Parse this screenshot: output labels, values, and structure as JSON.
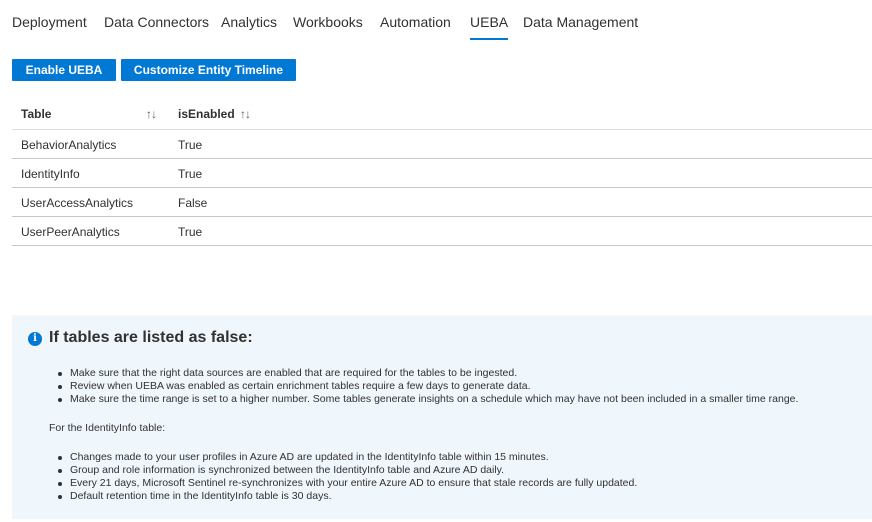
{
  "tabs": [
    {
      "label": "Deployment",
      "active": false
    },
    {
      "label": "Data Connectors",
      "active": false
    },
    {
      "label": "Analytics",
      "active": false
    },
    {
      "label": "Workbooks",
      "active": false
    },
    {
      "label": "Automation",
      "active": false
    },
    {
      "label": "UEBA",
      "active": true
    },
    {
      "label": "Data Management",
      "active": false
    }
  ],
  "toolbar": {
    "enable_ueba_label": "Enable UEBA",
    "customize_timeline_label": "Customize Entity Timeline"
  },
  "table": {
    "columns": [
      "Table",
      "isEnabled"
    ],
    "sort_icon": "sort-up-down-icon",
    "rows": [
      {
        "table": "BehaviorAnalytics",
        "isEnabled": "True"
      },
      {
        "table": "IdentityInfo",
        "isEnabled": "True"
      },
      {
        "table": "UserAccessAnalytics",
        "isEnabled": "False"
      },
      {
        "table": "UserPeerAnalytics",
        "isEnabled": "True"
      }
    ]
  },
  "info": {
    "icon": "info-icon",
    "title": "If tables are listed as false:",
    "bullets": [
      "Make sure that the right data sources are enabled that are required for the tables to be ingested.",
      "Review when UEBA was enabled as certain enrichment tables require a few days to generate data.",
      "Make sure the time range is set to a higher number. Some tables generate insights on a schedule which may have not been included in a smaller time range."
    ],
    "identity_heading": "For the IdentityInfo table:",
    "identity_bullets": [
      "Changes made to your user profiles in Azure AD are updated in the IdentityInfo table within 15 minutes.",
      "Group and role information is synchronized between the IdentityInfo table and Azure AD daily.",
      "Every 21 days, Microsoft Sentinel re-synchronizes with your entire Azure AD to ensure that stale records are fully updated.",
      "Default retention time in the IdentityInfo table is 30 days."
    ]
  },
  "colors": {
    "accent": "#0078d4",
    "info_background": "#eff6fc"
  }
}
